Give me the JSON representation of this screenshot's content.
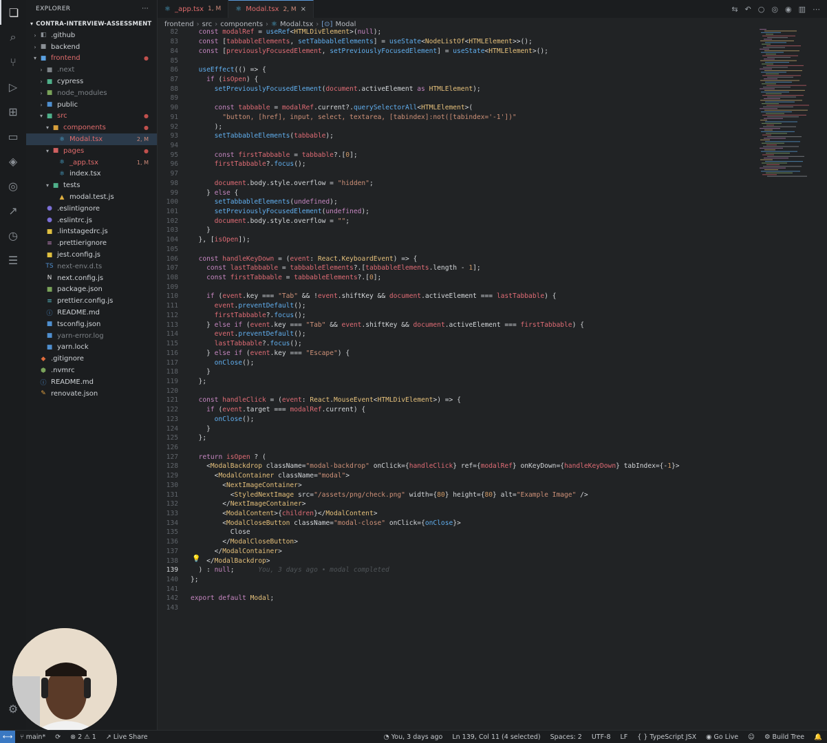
{
  "activity_bar": {
    "icons": [
      "files-icon",
      "search-icon",
      "source-control-icon",
      "run-debug-icon",
      "extensions-icon",
      "remote-explorer-icon",
      "docker-icon",
      "gitlens-icon",
      "live-share-icon",
      "timeline-icon",
      "outline-icon"
    ]
  },
  "sidebar": {
    "title": "EXPLORER",
    "more": "···",
    "section": "CONTRA-INTERVIEW-ASSESSMENT",
    "items": [
      {
        "label": ".github",
        "depth": 1,
        "kind": "folder",
        "open": false,
        "color": "#cfd3d7",
        "icon": "◧",
        "icon_color": "#8a8f95"
      },
      {
        "label": "backend",
        "depth": 1,
        "kind": "folder",
        "open": false,
        "color": "#cfd3d7",
        "icon": "■",
        "icon_color": "#8a8f95"
      },
      {
        "label": "frontend",
        "depth": 1,
        "kind": "folder",
        "open": true,
        "color": "#e06c6c",
        "icon": "■",
        "icon_color": "#5aa0e0",
        "badge": "●",
        "badge_color": "#c0504d"
      },
      {
        "label": ".next",
        "depth": 2,
        "kind": "folder",
        "open": false,
        "color": "#7d8287",
        "icon": "■",
        "icon_color": "#7d8287"
      },
      {
        "label": "cypress",
        "depth": 2,
        "kind": "folder",
        "open": false,
        "color": "#cfd3d7",
        "icon": "■",
        "icon_color": "#4fb08a"
      },
      {
        "label": "node_modules",
        "depth": 2,
        "kind": "folder",
        "open": false,
        "color": "#7d8287",
        "icon": "■",
        "icon_color": "#7aa35a"
      },
      {
        "label": "public",
        "depth": 2,
        "kind": "folder",
        "open": false,
        "color": "#cfd3d7",
        "icon": "■",
        "icon_color": "#4f8fcf"
      },
      {
        "label": "src",
        "depth": 2,
        "kind": "folder",
        "open": true,
        "color": "#e06c6c",
        "icon": "■",
        "icon_color": "#4fb08a",
        "badge": "●",
        "badge_color": "#c0504d"
      },
      {
        "label": "components",
        "depth": 3,
        "kind": "folder",
        "open": true,
        "color": "#e06c6c",
        "icon": "■",
        "icon_color": "#d9a03c",
        "badge": "●",
        "badge_color": "#c0504d"
      },
      {
        "label": "Modal.tsx",
        "depth": 4,
        "kind": "file",
        "color": "#e06c6c",
        "icon": "⚛",
        "icon_color": "#4fb5e0",
        "badge": "2, M",
        "badge_color": "#d08b7a",
        "selected": true
      },
      {
        "label": "pages",
        "depth": 3,
        "kind": "folder",
        "open": true,
        "color": "#e06c6c",
        "icon": "■",
        "icon_color": "#d06060",
        "badge": "●",
        "badge_color": "#c0504d"
      },
      {
        "label": "_app.tsx",
        "depth": 4,
        "kind": "file",
        "color": "#e06c6c",
        "icon": "⚛",
        "icon_color": "#4fb5e0",
        "badge": "1, M",
        "badge_color": "#d08b7a"
      },
      {
        "label": "index.tsx",
        "depth": 4,
        "kind": "file",
        "color": "#cfd3d7",
        "icon": "⚛",
        "icon_color": "#4fb5e0"
      },
      {
        "label": "tests",
        "depth": 3,
        "kind": "folder",
        "open": true,
        "color": "#cfd3d7",
        "icon": "■",
        "icon_color": "#4fb08a"
      },
      {
        "label": "modal.test.js",
        "depth": 4,
        "kind": "file",
        "color": "#cfd3d7",
        "icon": "▲",
        "icon_color": "#e0b040"
      },
      {
        "label": ".eslintignore",
        "depth": 2,
        "kind": "file",
        "color": "#cfd3d7",
        "icon": "●",
        "icon_color": "#7b6fd6"
      },
      {
        "label": ".eslintrc.js",
        "depth": 2,
        "kind": "file",
        "color": "#cfd3d7",
        "icon": "●",
        "icon_color": "#7b6fd6"
      },
      {
        "label": ".lintstagedrc.js",
        "depth": 2,
        "kind": "file",
        "color": "#cfd3d7",
        "icon": "■",
        "icon_color": "#e0c040"
      },
      {
        "label": ".prettierignore",
        "depth": 2,
        "kind": "file",
        "color": "#cfd3d7",
        "icon": "≡",
        "icon_color": "#c586c0"
      },
      {
        "label": "jest.config.js",
        "depth": 2,
        "kind": "file",
        "color": "#cfd3d7",
        "icon": "■",
        "icon_color": "#e0c040"
      },
      {
        "label": "next-env.d.ts",
        "depth": 2,
        "kind": "file",
        "color": "#7d8287",
        "icon": "TS",
        "icon_color": "#4f8fcf"
      },
      {
        "label": "next.config.js",
        "depth": 2,
        "kind": "file",
        "color": "#cfd3d7",
        "icon": "N",
        "icon_color": "#e6e6e6"
      },
      {
        "label": "package.json",
        "depth": 2,
        "kind": "file",
        "color": "#cfd3d7",
        "icon": "■",
        "icon_color": "#7aa35a"
      },
      {
        "label": "prettier.config.js",
        "depth": 2,
        "kind": "file",
        "color": "#cfd3d7",
        "icon": "≡",
        "icon_color": "#56b6c2"
      },
      {
        "label": "README.md",
        "depth": 2,
        "kind": "file",
        "color": "#cfd3d7",
        "icon": "ⓘ",
        "icon_color": "#4f8fcf"
      },
      {
        "label": "tsconfig.json",
        "depth": 2,
        "kind": "file",
        "color": "#cfd3d7",
        "icon": "■",
        "icon_color": "#4f8fcf"
      },
      {
        "label": "yarn-error.log",
        "depth": 2,
        "kind": "file",
        "color": "#7d8287",
        "icon": "■",
        "icon_color": "#4f8fcf"
      },
      {
        "label": "yarn.lock",
        "depth": 2,
        "kind": "file",
        "color": "#cfd3d7",
        "icon": "■",
        "icon_color": "#4f8fcf"
      },
      {
        "label": ".gitignore",
        "depth": 1,
        "kind": "file",
        "color": "#cfd3d7",
        "icon": "◆",
        "icon_color": "#e06c3c"
      },
      {
        "label": ".nvmrc",
        "depth": 1,
        "kind": "file",
        "color": "#cfd3d7",
        "icon": "⬢",
        "icon_color": "#7aa35a"
      },
      {
        "label": "README.md",
        "depth": 1,
        "kind": "file",
        "color": "#cfd3d7",
        "icon": "ⓘ",
        "icon_color": "#4f8fcf"
      },
      {
        "label": "renovate.json",
        "depth": 1,
        "kind": "file",
        "color": "#cfd3d7",
        "icon": "✎",
        "icon_color": "#e0a040"
      }
    ]
  },
  "tabs": [
    {
      "label": "_app.tsx",
      "badge": "1, M",
      "active": false
    },
    {
      "label": "Modal.tsx",
      "badge": "2, M",
      "active": true
    }
  ],
  "breadcrumbs": [
    "frontend",
    "src",
    "components",
    "Modal.tsx",
    "Modal"
  ],
  "code_lines": [
    {
      "n": "82",
      "t": "  const modalRef = useRef<HTMLDivElement>(null);"
    },
    {
      "n": "83",
      "t": "  const [tabbableElements, setTabbableElements] = useState<NodeListOf<HTMLElement>>();"
    },
    {
      "n": "84",
      "t": "  const [previouslyFocusedElement, setPreviouslyFocusedElement] = useState<HTMLElement>();"
    },
    {
      "n": "85",
      "t": ""
    },
    {
      "n": "86",
      "t": "  useEffect(() => {"
    },
    {
      "n": "87",
      "t": "    if (isOpen) {"
    },
    {
      "n": "88",
      "t": "      setPreviouslyFocusedElement(document.activeElement as HTMLElement);"
    },
    {
      "n": "89",
      "t": ""
    },
    {
      "n": "90",
      "t": "      const tabbable = modalRef.current?.querySelectorAll<HTMLElement>("
    },
    {
      "n": "91",
      "t": "        \"button, [href], input, select, textarea, [tabindex]:not([tabindex='-1'])\""
    },
    {
      "n": "92",
      "t": "      );"
    },
    {
      "n": "93",
      "t": "      setTabbableElements(tabbable);"
    },
    {
      "n": "94",
      "t": ""
    },
    {
      "n": "95",
      "t": "      const firstTabbable = tabbable?.[0];"
    },
    {
      "n": "96",
      "t": "      firstTabbable?.focus();"
    },
    {
      "n": "97",
      "t": ""
    },
    {
      "n": "98",
      "t": "      document.body.style.overflow = \"hidden\";"
    },
    {
      "n": "99",
      "t": "    } else {"
    },
    {
      "n": "100",
      "t": "      setTabbableElements(undefined);"
    },
    {
      "n": "101",
      "t": "      setPreviouslyFocusedElement(undefined);"
    },
    {
      "n": "102",
      "t": "      document.body.style.overflow = \"\";"
    },
    {
      "n": "103",
      "t": "    }"
    },
    {
      "n": "104",
      "t": "  }, [isOpen]);"
    },
    {
      "n": "105",
      "t": ""
    },
    {
      "n": "106",
      "t": "  const handleKeyDown = (event: React.KeyboardEvent) => {"
    },
    {
      "n": "107",
      "t": "    const lastTabbable = tabbableElements?.[tabbableElements.length - 1];"
    },
    {
      "n": "108",
      "t": "    const firstTabbable = tabbableElements?.[0];"
    },
    {
      "n": "109",
      "t": ""
    },
    {
      "n": "110",
      "t": "    if (event.key === \"Tab\" && !event.shiftKey && document.activeElement === lastTabbable) {"
    },
    {
      "n": "111",
      "t": "      event.preventDefault();"
    },
    {
      "n": "112",
      "t": "      firstTabbable?.focus();"
    },
    {
      "n": "113",
      "t": "    } else if (event.key === \"Tab\" && event.shiftKey && document.activeElement === firstTabbable) {"
    },
    {
      "n": "114",
      "t": "      event.preventDefault();"
    },
    {
      "n": "115",
      "t": "      lastTabbable?.focus();"
    },
    {
      "n": "116",
      "t": "    } else if (event.key === \"Escape\") {"
    },
    {
      "n": "117",
      "t": "      onClose();"
    },
    {
      "n": "118",
      "t": "    }"
    },
    {
      "n": "119",
      "t": "  };"
    },
    {
      "n": "120",
      "t": ""
    },
    {
      "n": "121",
      "t": "  const handleClick = (event: React.MouseEvent<HTMLDivElement>) => {"
    },
    {
      "n": "122",
      "t": "    if (event.target === modalRef.current) {"
    },
    {
      "n": "123",
      "t": "      onClose();"
    },
    {
      "n": "124",
      "t": "    }"
    },
    {
      "n": "125",
      "t": "  };"
    },
    {
      "n": "126",
      "t": ""
    },
    {
      "n": "127",
      "t": "  return isOpen ? ("
    },
    {
      "n": "128",
      "t": "    <ModalBackdrop className=\"modal-backdrop\" onClick={handleClick} ref={modalRef} onKeyDown={handleKeyDown} tabIndex={-1}>"
    },
    {
      "n": "129",
      "t": "      <ModalContainer className=\"modal\">"
    },
    {
      "n": "130",
      "t": "        <NextImageContainer>"
    },
    {
      "n": "131",
      "t": "          <StyledNextImage src=\"/assets/png/check.png\" width={80} height={80} alt=\"Example Image\" />"
    },
    {
      "n": "132",
      "t": "        </NextImageContainer>"
    },
    {
      "n": "133",
      "t": "        <ModalContent>{children}</ModalContent>"
    },
    {
      "n": "134",
      "t": "        <ModalCloseButton className=\"modal-close\" onClick={onClose}>"
    },
    {
      "n": "135",
      "t": "          Close"
    },
    {
      "n": "136",
      "t": "        </ModalCloseButton>"
    },
    {
      "n": "137",
      "t": "      </ModalContainer>"
    },
    {
      "n": "138",
      "t": "    </ModalBackdrop>"
    },
    {
      "n": "139",
      "t": "  ) : null;",
      "ghost": "      You, 3 days ago • modal completed",
      "current": true
    },
    {
      "n": "140",
      "t": "};"
    },
    {
      "n": "141",
      "t": ""
    },
    {
      "n": "142",
      "t": "export default Modal;"
    },
    {
      "n": "143",
      "t": ""
    }
  ],
  "statusbar": {
    "branch": "main*",
    "sync_icon": "⟳",
    "problems": "⊗ 2 ⚠ 1",
    "live_share": "Live Share",
    "blame": "You, 3 days ago",
    "cursor": "Ln 139, Col 11 (4 selected)",
    "spaces": "Spaces: 2",
    "encoding": "UTF-8",
    "eol": "LF",
    "language": "{ } TypeScript JSX",
    "go_live": "Go Live",
    "build_tree": "Build Tree"
  },
  "colors": {
    "keyword": "#c586c0",
    "type": "#e5c07b",
    "string": "#ce9178",
    "func": "#61afef",
    "var": "#e06c75",
    "accent": "#3a78c2"
  }
}
